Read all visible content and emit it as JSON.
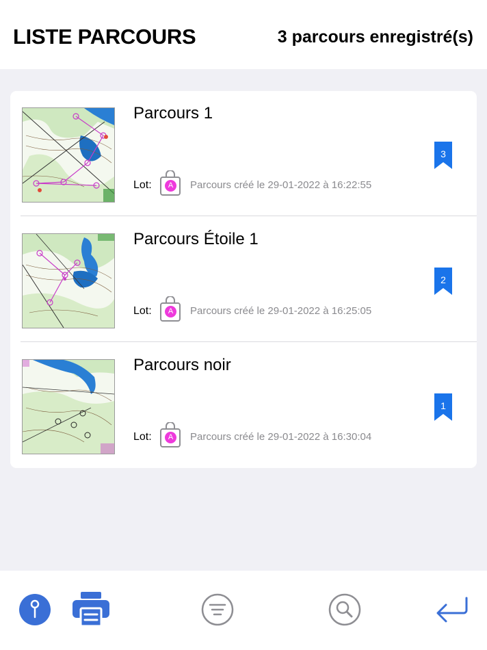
{
  "header": {
    "title": "LISTE PARCOURS",
    "count": "3 parcours enregistré(s)"
  },
  "courses": [
    {
      "name": "Parcours 1",
      "lot_label": "Lot:",
      "lot": "A",
      "created": "Parcours créé le 29-01-2022 à 16:22:55",
      "badge": "3"
    },
    {
      "name": "Parcours Étoile 1",
      "lot_label": "Lot:",
      "lot": "A",
      "created": "Parcours créé le 29-01-2022 à 16:25:05",
      "badge": "2"
    },
    {
      "name": "Parcours noir",
      "lot_label": "Lot:",
      "lot": "A",
      "created": "Parcours créé le 29-01-2022 à 16:30:04",
      "badge": "1"
    }
  ],
  "toolbar": {
    "icons": [
      "pin-icon",
      "printer-icon",
      "filter-icon",
      "search-icon",
      "return-icon"
    ]
  },
  "colors": {
    "accent": "#3a6fd6",
    "bookmark": "#1a74ea",
    "lot_badge": "#ee3adc",
    "icon_gray": "#8e8e93"
  }
}
